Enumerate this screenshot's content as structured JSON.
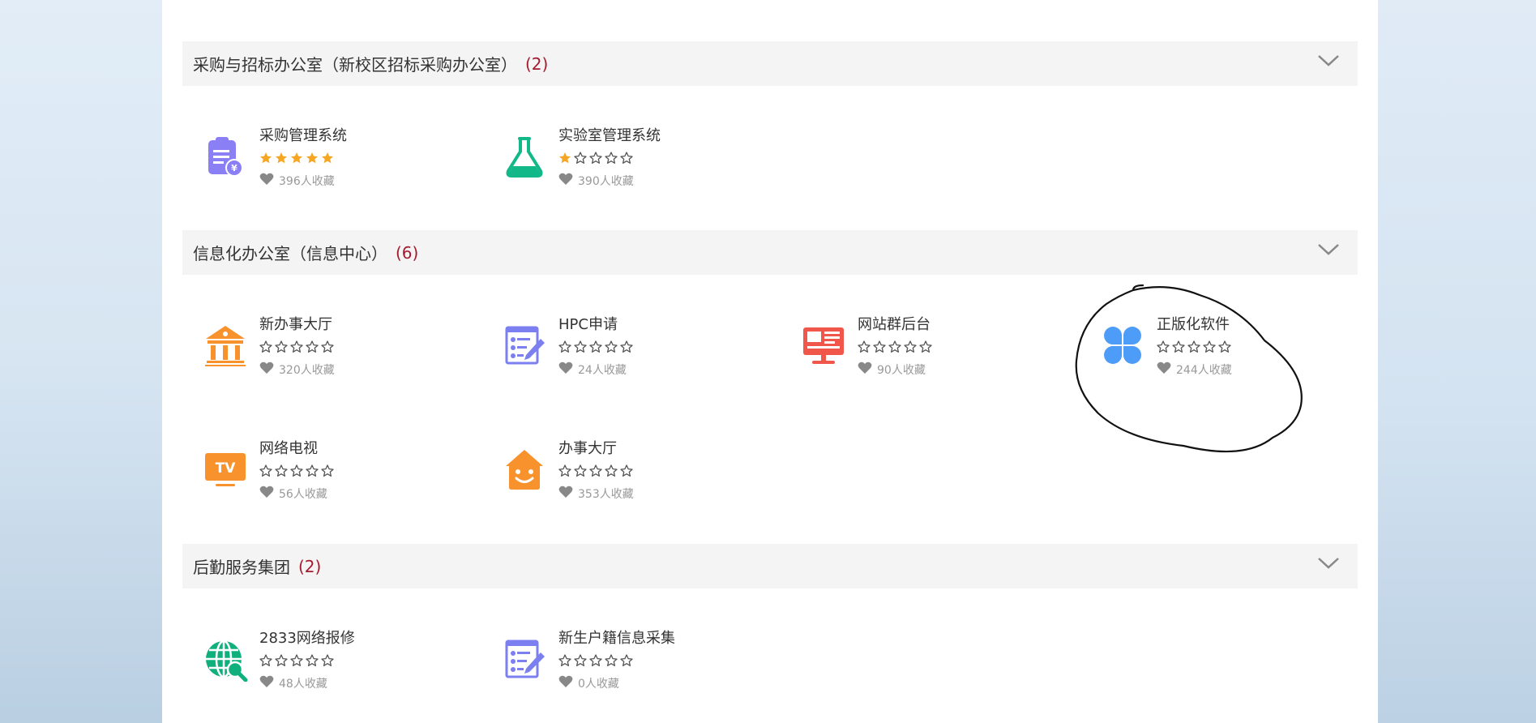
{
  "colors": {
    "header_bg": "#f4f4f4",
    "count_red": "#a6192e",
    "star_filled": "#f5a623",
    "star_empty": "#555555",
    "heart": "#888888"
  },
  "sections": [
    {
      "title": "采购与招标办公室（新校区招标采购办公室）",
      "count": "(2)",
      "items": [
        {
          "name": "采购管理系统",
          "icon": "clipboard-yen-icon",
          "rating": 5,
          "favorites": "396人收藏"
        },
        {
          "name": "实验室管理系统",
          "icon": "flask-icon",
          "rating": 1,
          "favorites": "390人收藏"
        }
      ]
    },
    {
      "title": "信息化办公室（信息中心）",
      "count": "(6)",
      "items": [
        {
          "name": "新办事大厅",
          "icon": "bank-building-icon",
          "rating": 0,
          "favorites": "320人收藏"
        },
        {
          "name": "HPC申请",
          "icon": "form-edit-icon",
          "rating": 0,
          "favorites": "24人收藏"
        },
        {
          "name": "网站群后台",
          "icon": "monitor-icon",
          "rating": 0,
          "favorites": "90人收藏"
        },
        {
          "name": "正版化软件",
          "icon": "clover-icon",
          "rating": 0,
          "favorites": "244人收藏"
        },
        {
          "name": "网络电视",
          "icon": "tv-icon",
          "rating": 0,
          "favorites": "56人收藏"
        },
        {
          "name": "办事大厅",
          "icon": "smiley-house-icon",
          "rating": 0,
          "favorites": "353人收藏"
        }
      ]
    },
    {
      "title": "后勤服务集团",
      "count": "(2)",
      "items": [
        {
          "name": "2833网络报修",
          "icon": "globe-wrench-icon",
          "rating": 0,
          "favorites": "48人收藏"
        },
        {
          "name": "新生户籍信息采集",
          "icon": "form-edit-icon",
          "rating": 0,
          "favorites": "0人收藏"
        }
      ]
    }
  ]
}
